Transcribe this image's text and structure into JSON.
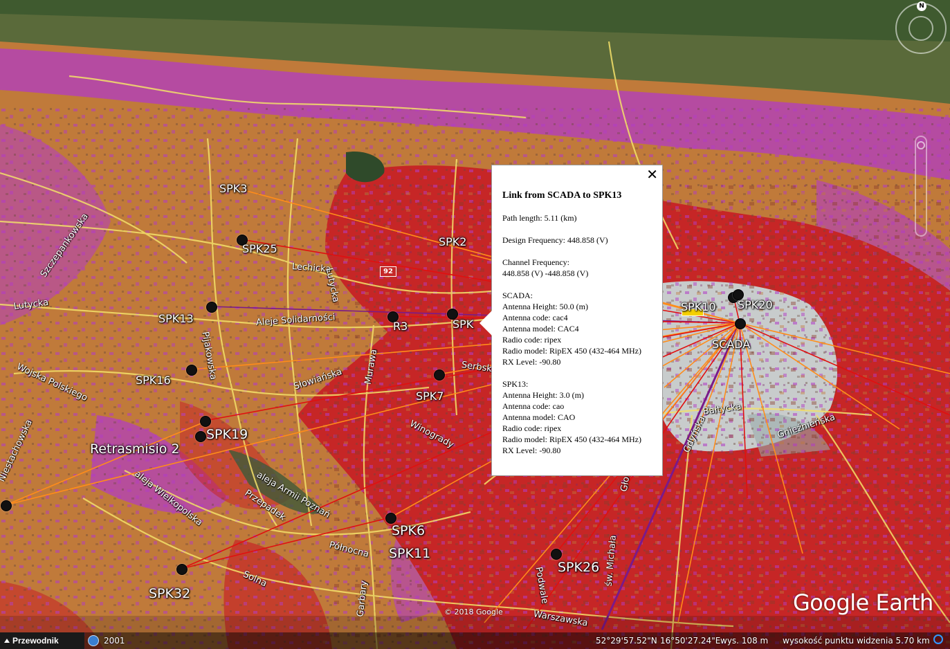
{
  "app": {
    "guide_button": "Przewodnik",
    "historical_year": "2001",
    "logo_text": "Google Earth",
    "copyright": "© 2018 Google",
    "compass_n": "N"
  },
  "status": {
    "latitude": "52°29'57.52\"N",
    "longitude": "16°50'27.24\"E",
    "elevation": "wys.  108 m",
    "eye_altitude": "wysokość punktu widzenia  5.70 km"
  },
  "route_badge": "92",
  "popup": {
    "title": "Link from SCADA to SPK13",
    "path_length": "Path length: 5.11 (km)",
    "design_frequency": "Design Frequency: 448.858 (V)",
    "channel_frequency_label": "Channel Frequency:",
    "channel_frequency_value": "448.858 (V) -448.858 (V)",
    "scada_header": "SCADA:",
    "scada_antenna_height": "Antenna Height: 50.0 (m)",
    "scada_antenna_code": "Antenna code: cac4",
    "scada_antenna_model": "Antenna model: CAC4",
    "scada_radio_code": "Radio code: ripex",
    "scada_radio_model": "Radio model: RipEX 450 (432-464 MHz)",
    "scada_rx_level": "RX Level: -90.80",
    "spk13_header": "SPK13:",
    "spk13_antenna_height": "Antenna Height: 3.0 (m)",
    "spk13_antenna_code": "Antenna code: cao",
    "spk13_antenna_model": "Antenna model: CAO",
    "spk13_radio_code": "Radio code: ripex",
    "spk13_radio_model": "Radio model: RipEX 450 (432-464 MHz)",
    "spk13_rx_level": "RX Level: -90.80",
    "close_symbol": "✕"
  },
  "stations": {
    "spk3": "SPK3",
    "spk25": "SPK25",
    "spk2": "SPK2",
    "spk13": "SPK13",
    "r3": "R3",
    "spk_partial": "SPK",
    "spk16": "SPK16",
    "spk7": "SPK7",
    "spk19": "SPK19",
    "retrasmisio2": "Retrasmisio 2",
    "spk6": "SPK6",
    "spk11": "SPK11",
    "spk26": "SPK26",
    "spk32": "SPK32",
    "spk10": "SPK10",
    "spk20": "SPK20",
    "scada": "SCADA"
  },
  "streets": {
    "lechicka": "Lechicka",
    "lutycka": "Lutycka",
    "aleje_solidarnosci": "Aleje Solidarności",
    "pijanowska": "Pijakowska",
    "slowianska": "Słowiańska",
    "murawa": "Murawa",
    "serbska": "Serbska",
    "winogrady": "Winogrady",
    "wojska_polskiego": "Wojska Polskiego",
    "niestachowska": "Niestachowska",
    "aleja_wielkopolska": "aleja Wielkopolska",
    "aleja_armii_poznan": "aleja Armii Poznań",
    "przepadek": "Przepadek",
    "polnocna": "Północna",
    "solna": "Solna",
    "garbary": "Garbary",
    "podwale": "Podwale",
    "sw_michala": "św. Michała",
    "warszawska": "Warszawska",
    "baltycka": "Bałtycka",
    "gdynska": "Gdyńska",
    "gnieznienska": "Gnieźnieńska",
    "glogowska": "Gło",
    "lutycka2": "Lutycka",
    "szczepankowska": "Szczepankowska"
  },
  "colors": {
    "coverage_red": "#c62626",
    "coverage_orange": "#c07a3a",
    "coverage_magenta": "#b23cc4",
    "link_orange": "#ff8c1a",
    "link_red": "#e01010",
    "link_purple": "#7a1a8a",
    "road_yellow": "#f3e06a"
  }
}
